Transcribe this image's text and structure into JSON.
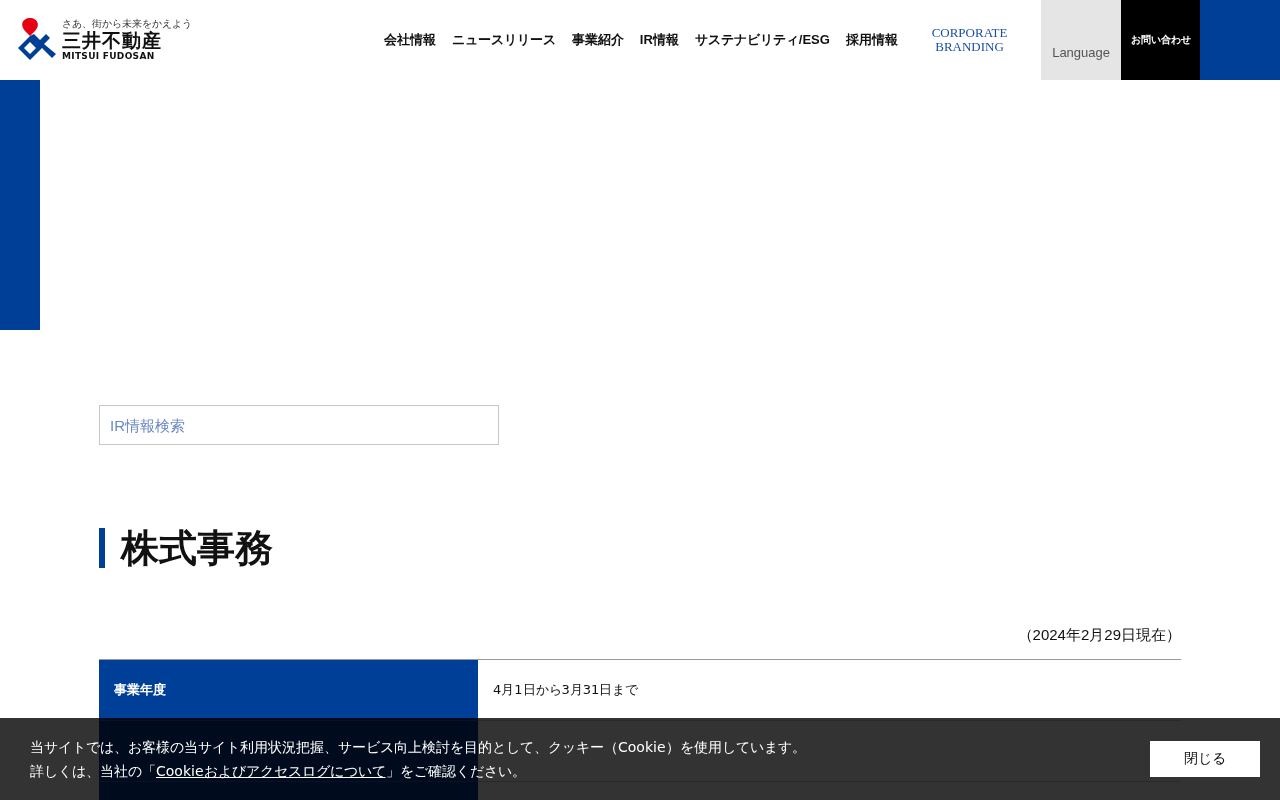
{
  "header": {
    "logo": {
      "tagline": "さあ、街から未来をかえよう",
      "name": "三井不動産",
      "name_en": "MITSUI FUDOSAN"
    },
    "nav": [
      "会社情報",
      "ニュースリリース",
      "事業紹介",
      "IR情報",
      "サステナビリティ/ESG",
      "採用情報"
    ],
    "branding": [
      "CORPORATE",
      "BRANDING"
    ],
    "language": "Language",
    "contact": "お問い合わせ"
  },
  "search": {
    "placeholder": "IR情報検索"
  },
  "heading": "株式事務",
  "as_of": "（2024年2月29日現在）",
  "table": {
    "rows": [
      {
        "label": "事業年度",
        "value": "4月1日から3月31日まで"
      }
    ]
  },
  "cookie_banner": {
    "line1": "当サイトでは、お客様の当サイト利用状況把握、サービス向上検討を目的として、クッキー（Cookie）を使用しています。",
    "line2_before": "詳しくは、当社の「",
    "link": "Cookieおよびアクセスログについて",
    "line2_after": "」をご確認ください。",
    "button": "閉じる"
  }
}
